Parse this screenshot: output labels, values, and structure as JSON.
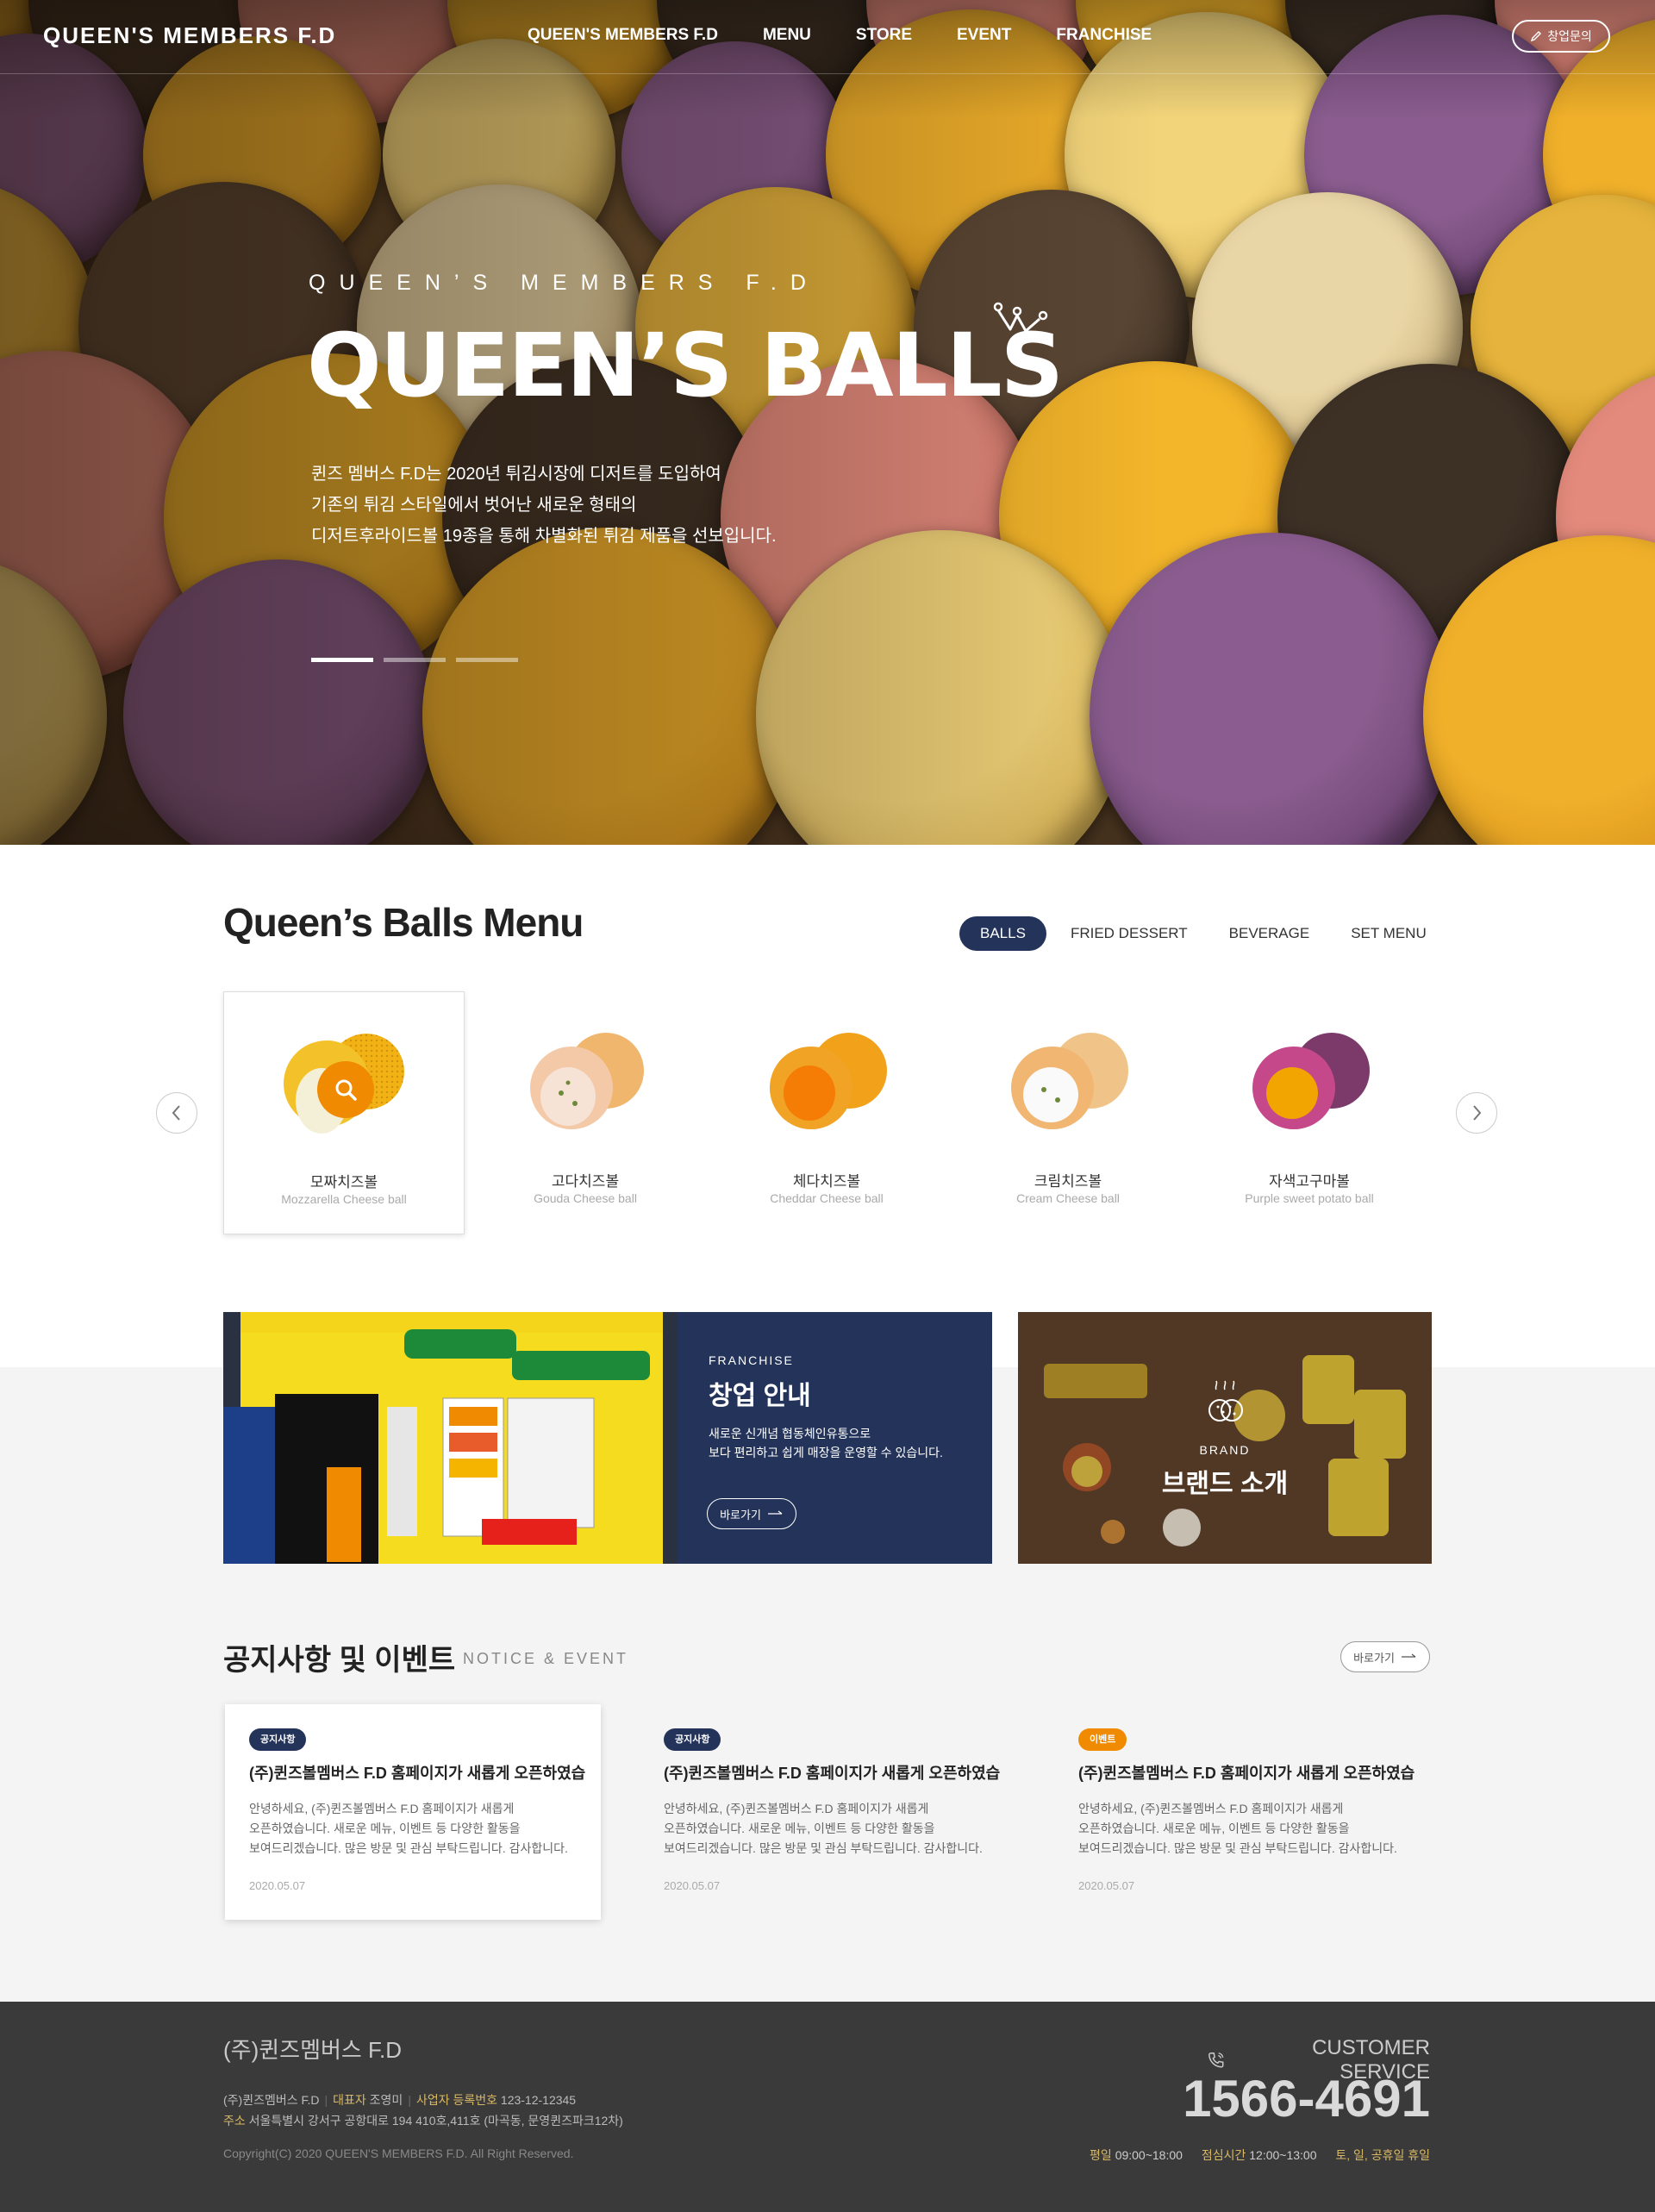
{
  "header": {
    "logo": "QUEEN'S MEMBERS F.D",
    "nav": [
      "QUEEN'S MEMBERS F.D",
      "MENU",
      "STORE",
      "EVENT",
      "FRANCHISE"
    ],
    "consult_label": "창업문의"
  },
  "hero": {
    "subtitle": "QUEEN’S MEMBERS F.D",
    "title": "QUEEN’S BALLS",
    "desc_lines": [
      "퀸즈 멤버스 F.D는 2020년 튀김시장에 디저트를 도입하여",
      "기존의 튀김 스타일에서 벗어난 새로운 형태의",
      "디저트후라이드볼 19종을 통해 차별화된 튀김 제품을 선보입니다."
    ],
    "slide_active": 1,
    "slide_count": 3
  },
  "menu": {
    "title": "Queen’s Balls Menu",
    "tabs": [
      "BALLS",
      "FRIED DESSERT",
      "BEVERAGE",
      "SET MENU"
    ],
    "active_tab": "BALLS",
    "prev_icon": "chevron-left-icon",
    "next_icon": "chevron-right-icon",
    "products": [
      {
        "name": "모짜치즈볼",
        "name_en": "Mozzarella Cheese ball",
        "selected": true
      },
      {
        "name": "고다치즈볼",
        "name_en": "Gouda Cheese ball"
      },
      {
        "name": "체다치즈볼",
        "name_en": "Cheddar Cheese ball"
      },
      {
        "name": "크림치즈볼",
        "name_en": "Cream Cheese ball"
      },
      {
        "name": "자색고구마볼",
        "name_en": "Purple sweet potato ball"
      }
    ]
  },
  "franchise": {
    "label": "FRANCHISE",
    "title": "창업 안내",
    "desc": [
      "새로운 신개념 협동체인유통으로",
      "보다 편리하고 쉽게 매장을 운영할 수 있습니다."
    ],
    "button": "바로가기"
  },
  "brand": {
    "label": "BRAND",
    "title": "브랜드 소개"
  },
  "notice": {
    "title": "공지사항 및 이벤트",
    "subtitle": "NOTICE & EVENT",
    "more": "바로가기",
    "cards": [
      {
        "badge": "공지사항",
        "type": "notice",
        "title": "(주)퀸즈볼멤버스 F.D 홈페이지가 새롭게 오픈하였습...",
        "body": [
          "안녕하세요, (주)퀸즈볼멤버스 F.D 홈페이지가 새롭게",
          "오픈하였습니다. 새로운 메뉴, 이벤트 등 다양한 활동을",
          "보여드리겠습니다. 많은 방문 및 관심 부탁드립니다. 감사합니다."
        ],
        "date": "2020.05.07"
      },
      {
        "badge": "공지사항",
        "type": "notice",
        "title": "(주)퀸즈볼멤버스 F.D 홈페이지가 새롭게 오픈하였습...",
        "body": [
          "안녕하세요, (주)퀸즈볼멤버스 F.D 홈페이지가 새롭게",
          "오픈하였습니다. 새로운 메뉴, 이벤트 등 다양한 활동을",
          "보여드리겠습니다. 많은 방문 및 관심 부탁드립니다. 감사합니다."
        ],
        "date": "2020.05.07"
      },
      {
        "badge": "이벤트",
        "type": "event",
        "title": "(주)퀸즈볼멤버스 F.D 홈페이지가 새롭게 오픈하였습...",
        "body": [
          "안녕하세요, (주)퀸즈볼멤버스 F.D 홈페이지가 새롭게",
          "오픈하였습니다. 새로운 메뉴, 이벤트 등 다양한 활동을",
          "보여드리겠습니다. 많은 방문 및 관심 부탁드립니다. 감사합니다."
        ],
        "date": "2020.05.07"
      }
    ]
  },
  "footer": {
    "company": "(주)퀸즈멤버스 F.D",
    "company_small": "(주)퀸즈멤버스 F.D",
    "ceo_key": "대표자",
    "ceo": "조영미",
    "biz_key": "사업자 등록번호",
    "biz": "123-12-12345",
    "addr_key": "주소",
    "addr": "서울특별시 강서구 공항대로 194  410호,411호 (마곡동, 문영퀸즈파크12차)",
    "copyright": "Copyright(C) 2020 QUEEN'S MEMBERS F.D.  All Right Reserved.",
    "cs_title": "CUSTOMER SERVICE",
    "cs_phone": "1566-4691",
    "weekday_key": "평일",
    "weekday": "09:00~18:00",
    "lunch_key": "점심시간",
    "lunch": "12:00~13:00",
    "holiday_key": "토, 일, 공휴일 휴일"
  },
  "colors": {
    "navy": "#23335a",
    "orange": "#f08a00",
    "footer_bg": "#3a3a3a",
    "footer_key": "#d8b866"
  }
}
